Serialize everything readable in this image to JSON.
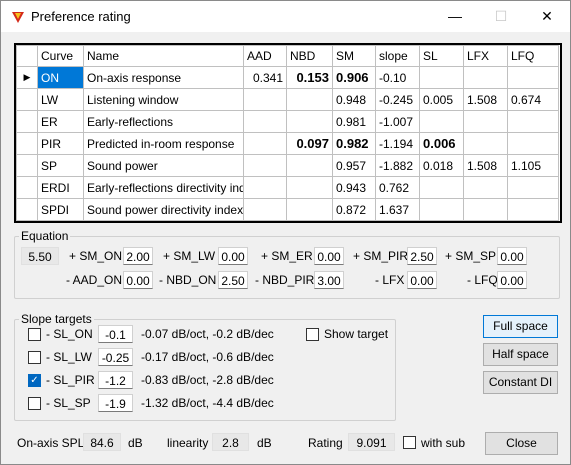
{
  "window": {
    "title": "Preference rating",
    "min": "—",
    "max": "☐",
    "close": "✕"
  },
  "table": {
    "headers": [
      "Curve",
      "Name",
      "AAD",
      "NBD",
      "SM",
      "slope",
      "SL",
      "LFX",
      "LFQ"
    ],
    "rows": [
      {
        "curve": "ON",
        "name": "On-axis response",
        "aad": "0.341",
        "nbd": "0.153",
        "sm": "0.906",
        "slope": "-0.10",
        "sl": "",
        "lfx": "",
        "lfq": "",
        "marker": "▶"
      },
      {
        "curve": "LW",
        "name": "Listening window",
        "aad": "",
        "nbd": "",
        "sm": "0.948",
        "slope": "-0.245",
        "sl": "0.005",
        "lfx": "1.508",
        "lfq": "0.674",
        "marker": ""
      },
      {
        "curve": "ER",
        "name": "Early-reflections",
        "aad": "",
        "nbd": "",
        "sm": "0.981",
        "slope": "-1.007",
        "sl": "",
        "lfx": "",
        "lfq": "",
        "marker": ""
      },
      {
        "curve": "PIR",
        "name": "Predicted in-room response",
        "aad": "",
        "nbd": "0.097",
        "sm": "0.982",
        "slope": "-1.194",
        "sl": "0.006",
        "lfx": "",
        "lfq": "",
        "marker": ""
      },
      {
        "curve": "SP",
        "name": "Sound power",
        "aad": "",
        "nbd": "",
        "sm": "0.957",
        "slope": "-1.882",
        "sl": "0.018",
        "lfx": "1.508",
        "lfq": "1.105",
        "marker": ""
      },
      {
        "curve": "ERDI",
        "name": "Early-reflections directivity index",
        "aad": "",
        "nbd": "",
        "sm": "0.943",
        "slope": "0.762",
        "sl": "",
        "lfx": "",
        "lfq": "",
        "marker": ""
      },
      {
        "curve": "SPDI",
        "name": "Sound power directivity index",
        "aad": "",
        "nbd": "",
        "sm": "0.872",
        "slope": "1.637",
        "sl": "",
        "lfx": "",
        "lfq": "",
        "marker": ""
      }
    ]
  },
  "equation": {
    "label": "Equation",
    "const": "5.50",
    "sm_on_label": "+ SM_ON",
    "sm_on": "2.00",
    "sm_lw_label": "+ SM_LW",
    "sm_lw": "0.00",
    "sm_er_label": "+ SM_ER",
    "sm_er": "0.00",
    "sm_pir_label": "+ SM_PIR",
    "sm_pir": "2.50",
    "sm_sp_label": "+ SM_SP",
    "sm_sp": "0.00",
    "aad_on_label": "- AAD_ON",
    "aad_on": "0.00",
    "nbd_on_label": "- NBD_ON",
    "nbd_on": "2.50",
    "nbd_pir_label": "- NBD_PIR",
    "nbd_pir": "3.00",
    "lfx_label": "- LFX",
    "lfx": "0.00",
    "lfq_label": "- LFQ",
    "lfq": "0.00"
  },
  "slope": {
    "label": "Slope targets",
    "show_target": "Show target",
    "rows": [
      {
        "label": "- SL_ON",
        "value": "-0.1",
        "desc": "-0.07 dB/oct, -0.2 dB/dec",
        "checked": false
      },
      {
        "label": "- SL_LW",
        "value": "-0.25",
        "desc": "-0.17 dB/oct, -0.6 dB/dec",
        "checked": false
      },
      {
        "label": "- SL_PIR",
        "value": "-1.2",
        "desc": "-0.83 dB/oct, -2.8 dB/dec",
        "checked": true
      },
      {
        "label": "- SL_SP",
        "value": "-1.9",
        "desc": "-1.32 dB/oct, -4.4 dB/dec",
        "checked": false
      }
    ]
  },
  "buttons": {
    "full_space": "Full space",
    "half_space": "Half space",
    "constant_di": "Constant DI",
    "close": "Close"
  },
  "footer": {
    "spl_label": "On-axis SPL",
    "spl": "84.6",
    "spl_unit": "dB",
    "lin_label": "linearity",
    "lin": "2.8",
    "lin_unit": "dB",
    "rating_label": "Rating",
    "rating": "9.091",
    "with_sub": "with sub"
  },
  "colors": {
    "selection": "#0078d7",
    "accent": "#0067c0"
  }
}
